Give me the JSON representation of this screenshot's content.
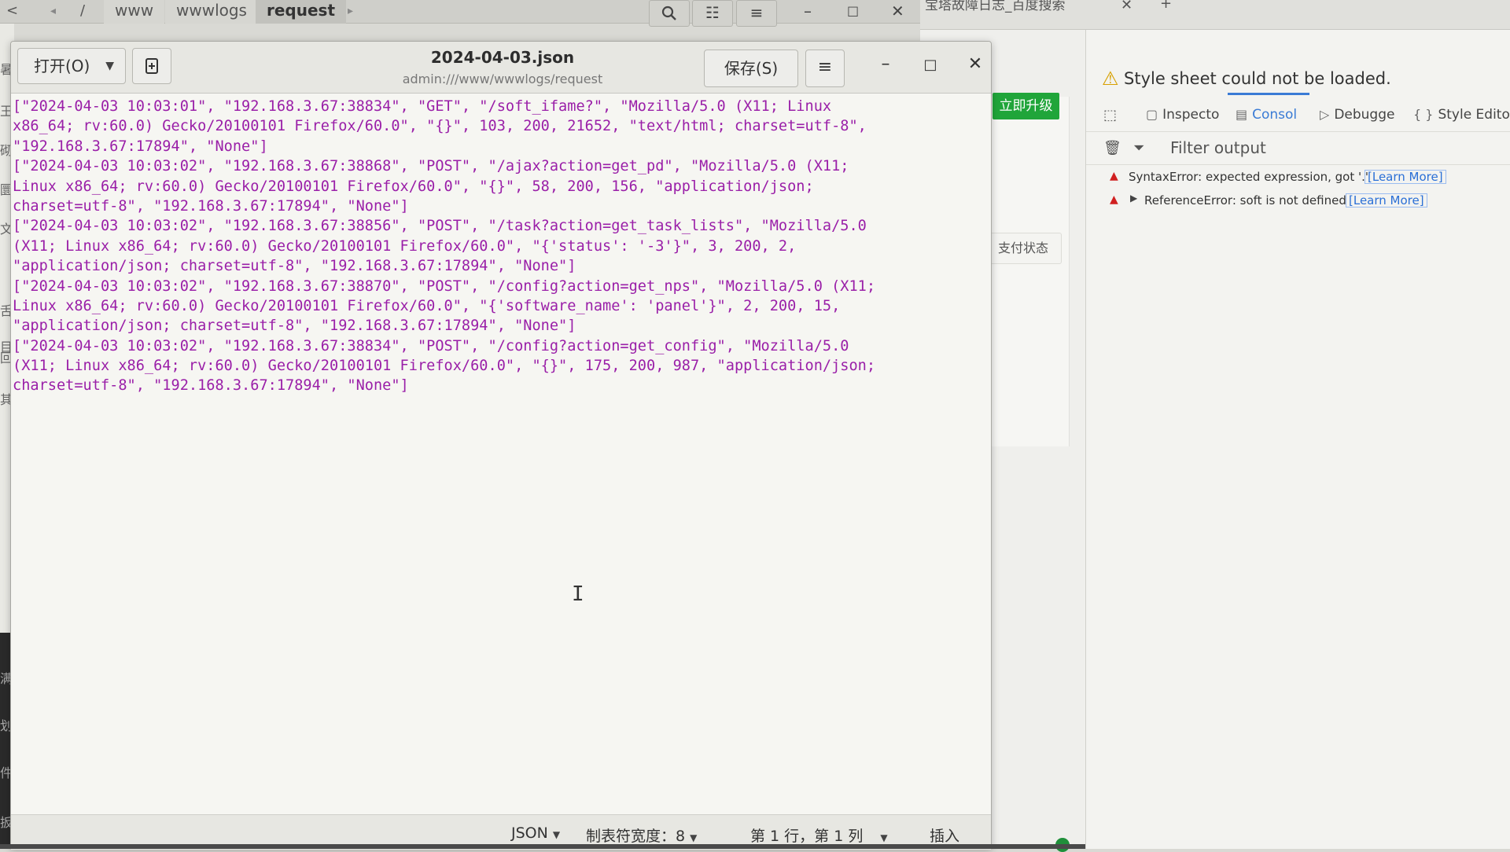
{
  "file_manager": {
    "nav_back": "<",
    "path_sep": "/",
    "crumbs": [
      "www",
      "wwwlogs",
      "request"
    ],
    "crumb_next": "▸",
    "search_icon": "search-icon",
    "view_icon": "list-view-icon",
    "menu_icon": "hamburger-icon",
    "minimize": "–",
    "maximize": "□",
    "close": "✕"
  },
  "left_strip_glyphs": [
    "暑",
    "王",
    "砌",
    "圜",
    "文",
    "舌",
    "目",
    "回",
    "其"
  ],
  "left_dark_glyphs": [
    "满",
    "划",
    "件",
    "扳"
  ],
  "browser": {
    "tab_title": "宝塔故障日志_百度搜索",
    "tab_close": "✕",
    "new_tab": "+",
    "upgrade_button": "立即升级",
    "pay_status": "支付状态"
  },
  "devtools": {
    "warning": "Style sheet could not be loaded.",
    "tabs": [
      {
        "label": "Inspecto",
        "icon": "inspector-icon"
      },
      {
        "label": "Consol",
        "icon": "console-icon"
      },
      {
        "label": "Debugge",
        "icon": "debugger-icon"
      },
      {
        "label": "Style Edito",
        "icon": "style-editor-icon"
      }
    ],
    "filter_placeholder": "Filter output",
    "messages": [
      {
        "text": "SyntaxError: expected expression, got '.'",
        "link": "[Learn More]"
      },
      {
        "text": "ReferenceError: soft is not defined",
        "link": "[Learn More]"
      }
    ]
  },
  "editor": {
    "open_label": "打开(O)",
    "title": "2024-04-03.json",
    "subtitle": "admin:///www/wwwlogs/request",
    "save_label": "保存(S)",
    "minimize": "–",
    "maximize": "□",
    "close": "✕",
    "lines": [
      "[\"2024-04-03 10:03:01\", \"192.168.3.67:38834\", \"GET\", \"/soft_ifame?\", \"Mozilla/5.0 (X11; Linux",
      "x86_64; rv:60.0) Gecko/20100101 Firefox/60.0\", \"{}\", 103, 200, 21652, \"text/html; charset=utf-8\",",
      "\"192.168.3.67:17894\", \"None\"]",
      "[\"2024-04-03 10:03:02\", \"192.168.3.67:38868\", \"POST\", \"/ajax?action=get_pd\", \"Mozilla/5.0 (X11;",
      "Linux x86_64; rv:60.0) Gecko/20100101 Firefox/60.0\", \"{}\", 58, 200, 156, \"application/json;",
      "charset=utf-8\", \"192.168.3.67:17894\", \"None\"]",
      "[\"2024-04-03 10:03:02\", \"192.168.3.67:38856\", \"POST\", \"/task?action=get_task_lists\", \"Mozilla/5.0",
      "(X11; Linux x86_64; rv:60.0) Gecko/20100101 Firefox/60.0\", \"{'status': '-3'}\", 3, 200, 2,",
      "\"application/json; charset=utf-8\", \"192.168.3.67:17894\", \"None\"]",
      "[\"2024-04-03 10:03:02\", \"192.168.3.67:38870\", \"POST\", \"/config?action=get_nps\", \"Mozilla/5.0 (X11;",
      "Linux x86_64; rv:60.0) Gecko/20100101 Firefox/60.0\", \"{'software_name': 'panel'}\", 2, 200, 15,",
      "\"application/json; charset=utf-8\", \"192.168.3.67:17894\", \"None\"]",
      "[\"2024-04-03 10:03:02\", \"192.168.3.67:38834\", \"POST\", \"/config?action=get_config\", \"Mozilla/5.0",
      "(X11; Linux x86_64; rv:60.0) Gecko/20100101 Firefox/60.0\", \"{}\", 175, 200, 987, \"application/json;",
      "charset=utf-8\", \"192.168.3.67:17894\", \"None\"]"
    ],
    "text_color": "#9a1fa8",
    "status": {
      "language": "JSON",
      "tab_width": "制表符宽度：8",
      "position": "第 1 行，第 1 列",
      "mode": "插入"
    }
  }
}
